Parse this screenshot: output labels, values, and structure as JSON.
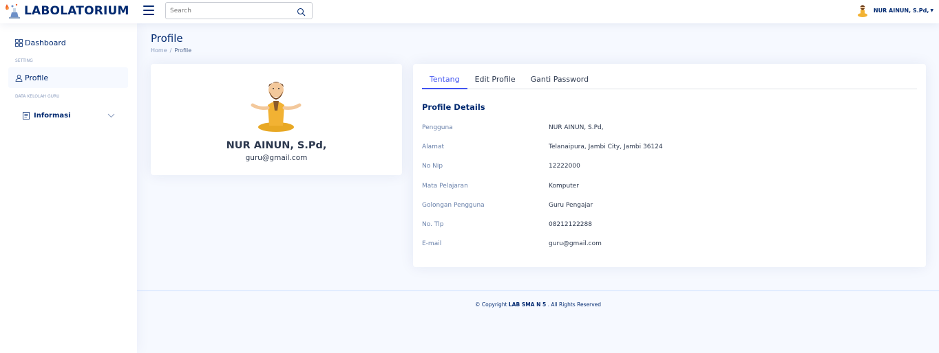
{
  "header": {
    "logo_text": "LABOLATORIUM",
    "search_placeholder": "Search",
    "user_name": "NUR AINUN, S.Pd,"
  },
  "sidebar": {
    "dashboard_label": "Dashboard",
    "heading_setting": "SETTING",
    "profile_label": "Profile",
    "heading_data": "DATA KELOLAH GURU",
    "informasi_label": "Informasi"
  },
  "page": {
    "title": "Profile",
    "breadcrumb_home": "Home",
    "breadcrumb_sep": "/",
    "breadcrumb_current": "Profile"
  },
  "profile_card": {
    "name": "NUR AINUN, S.Pd,",
    "email": "guru@gmail.com"
  },
  "tabs": [
    "Tentang",
    "Edit Profile",
    "Ganti Password"
  ],
  "details": {
    "title": "Profile Details",
    "rows": [
      {
        "label": "Pengguna",
        "value": "NUR AINUN, S.Pd,"
      },
      {
        "label": "Alamat",
        "value": "Telanaipura, Jambi City, Jambi 36124"
      },
      {
        "label": "No Nip",
        "value": "12222000"
      },
      {
        "label": "Mata Pelajaran",
        "value": "Komputer"
      },
      {
        "label": "Golongan Pengguna",
        "value": "Guru Pengajar"
      },
      {
        "label": "No. Tlp",
        "value": "08212122288"
      },
      {
        "label": "E-mail",
        "value": "guru@gmail.com"
      }
    ]
  },
  "footer": {
    "prefix": "© Copyright",
    "brand": "LAB SMA N 5",
    "suffix": ". All Rights Reserved"
  },
  "colors": {
    "primary": "#012970",
    "accent": "#4154f1",
    "background": "#f6f9ff"
  }
}
